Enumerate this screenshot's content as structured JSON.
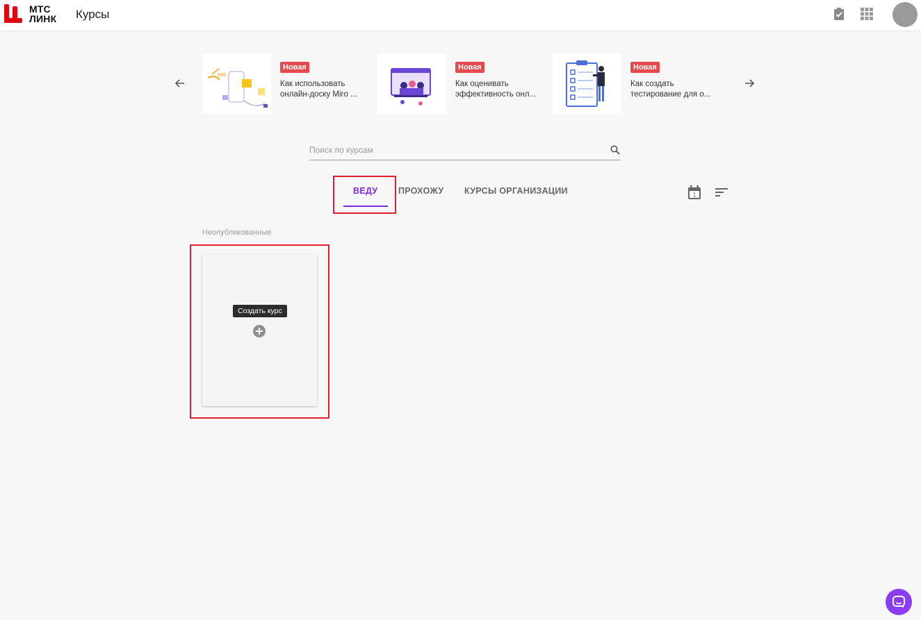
{
  "header": {
    "logo_line1": "МТС",
    "logo_line2": "ЛИНК",
    "title": "Курсы",
    "icons": [
      "clipboard-check-icon",
      "apps-grid-icon",
      "avatar"
    ]
  },
  "carousel": {
    "prev_icon": "arrow-left-icon",
    "next_icon": "arrow-right-icon",
    "items": [
      {
        "badge": "Новая",
        "title_line1": "Как использовать",
        "title_line2": "онлайн-доску Miro ..."
      },
      {
        "badge": "Новая",
        "title_line1": "Как оценивать",
        "title_line2": "эффективность онл..."
      },
      {
        "badge": "Новая",
        "title_line1": "Как создать",
        "title_line2": "тестирование для о..."
      }
    ]
  },
  "search": {
    "placeholder": "Поиск по курсам",
    "value": ""
  },
  "tabs": [
    {
      "label": "Веду",
      "active": true
    },
    {
      "label": "Прохожу",
      "active": false
    },
    {
      "label": "Курсы организации",
      "active": false
    }
  ],
  "tools": {
    "calendar_day": "1"
  },
  "section": {
    "label": "Неопубликованные"
  },
  "create_card": {
    "tooltip": "Создать курс"
  },
  "colors": {
    "accent": "#7a2be0",
    "badge": "#e5484d",
    "highlight": "#e01e2c",
    "chat": "#8a3df0",
    "logo": "#e30611"
  }
}
